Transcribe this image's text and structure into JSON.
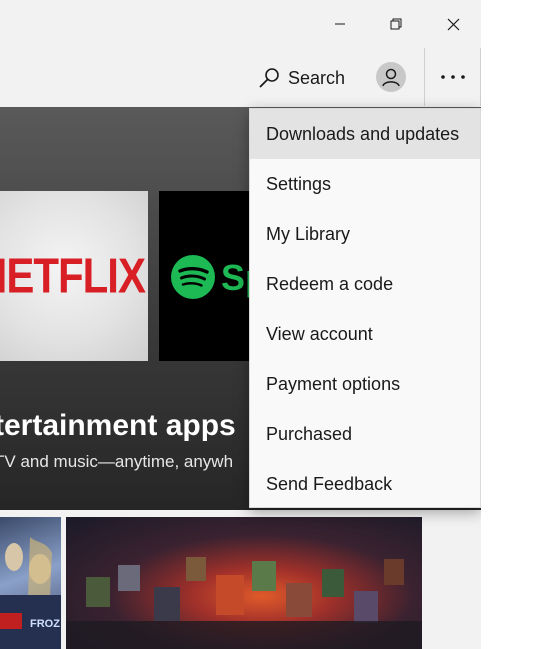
{
  "topbar": {
    "search_label": "Search"
  },
  "hero": {
    "title": "tertainment apps",
    "subtitle": "TV and music—anytime, anywh",
    "tiles": [
      {
        "name": "netflix",
        "label": "NETFLIX",
        "color": "#d81f26"
      },
      {
        "name": "spotify",
        "label": "Sp",
        "color": "#1db954"
      }
    ]
  },
  "menu": {
    "items": [
      {
        "label": "Downloads and updates"
      },
      {
        "label": "Settings"
      },
      {
        "label": "My Library"
      },
      {
        "label": "Redeem a code"
      },
      {
        "label": "View account"
      },
      {
        "label": "Payment options"
      },
      {
        "label": "Purchased"
      },
      {
        "label": "Send Feedback"
      }
    ]
  },
  "icons": {
    "minimize": "minimize-icon",
    "restore": "restore-icon",
    "close": "close-icon",
    "search": "search-icon",
    "account": "account-icon",
    "more": "more-icon"
  },
  "colors": {
    "accent_hover": "#e3e3e3",
    "netflix_red": "#d81f26",
    "spotify_green": "#1db954"
  }
}
